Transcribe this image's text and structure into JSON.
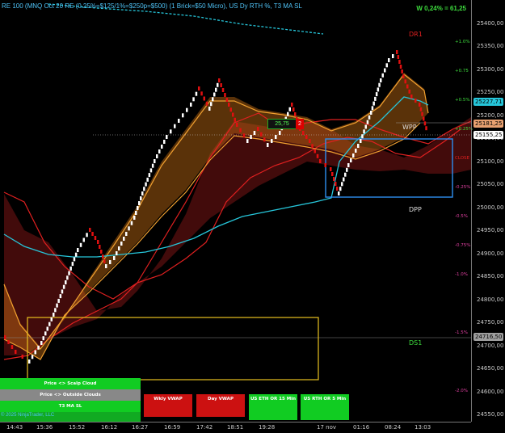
{
  "chart": {
    "title": "RE 100 (MNQ Oct 20 RE (0.25%=$125/1%=$250p=$500)  (1 Brick=$50 Micro), US Dy RTH %, T3 MA SL",
    "weekly_change": "W 0,24% = 61,25",
    "copyright": "© 2025 NinjaTrader, LLC",
    "price_axis": [
      "25400,00",
      "25350,00",
      "25300,00",
      "25250,00",
      "25200,00",
      "25150,00",
      "25100,00",
      "25050,00",
      "25000,00",
      "24950,00",
      "24900,00",
      "24850,00",
      "24800,00",
      "24750,00",
      "24700,00",
      "24650,00",
      "24600,00",
      "24550,00"
    ],
    "price_tags": [
      {
        "label": "25227,71",
        "color": "#26c6da"
      },
      {
        "label": "25181,25",
        "color": "#e8a070"
      },
      {
        "label": "25155,25",
        "color": "#ffffff"
      },
      {
        "label": "24716,50",
        "color": "#9e9e9e"
      }
    ],
    "pct_levels": [
      "+1.0%",
      "+0.75",
      "+0.5%",
      "+0.25%",
      "CLOSE",
      "-0.25%",
      "-0.5%",
      "-0.75%",
      "-1.0%",
      "-1.5%",
      "-2.0%"
    ],
    "pivots": {
      "dr1": "DR1",
      "wpp": "WPP",
      "dpp": "DPP",
      "ds1": "DS1"
    },
    "time_axis": [
      "14:43",
      "15:36",
      "15:52",
      "16:12",
      "16:27",
      "16:59",
      "17:42",
      "18:51",
      "19:28",
      "17 nov",
      "01:16",
      "08:24",
      "13:03"
    ],
    "last_price_box": "25,75",
    "position_qty": "2"
  },
  "buttons": {
    "scalp_cloud": "Price <> Scalp Cloud",
    "outside_clouds": "Price <> Outside Clouds",
    "t3_ma_sl": "T3 MA SL",
    "wkly_vwap": "Wkly VWAP",
    "day_vwap": "Day VWAP",
    "us_eth_or": "US ETH OR 15 Min",
    "us_rth_or": "US RTH OR 5 Min"
  },
  "colors": {
    "bull_brick": "#ffffff",
    "bear_brick": "#e01010",
    "cloud_orange": "#f0a030",
    "cloud_red": "#e02020",
    "ma_cyan": "#26c6da",
    "button_green": "#11cc22",
    "button_red": "#cc1111"
  }
}
